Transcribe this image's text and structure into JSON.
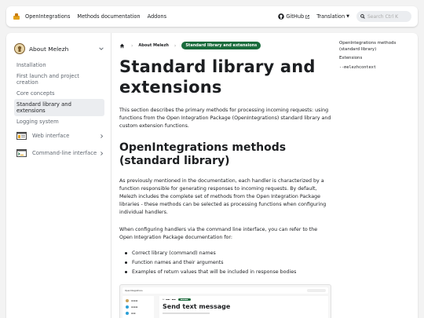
{
  "navbar": {
    "brand": "OpenIntegrations",
    "links": [
      "Methods documentation",
      "Addons"
    ],
    "github": "GitHub",
    "translation": "Translation",
    "search_placeholder": "Search Ctrl K"
  },
  "sidebar": {
    "header": "About Melezh",
    "items": [
      {
        "label": "Installation",
        "active": false
      },
      {
        "label": "First launch and project creation",
        "active": false
      },
      {
        "label": "Core concepts",
        "active": false
      },
      {
        "label": "Standard library and extensions",
        "active": true
      },
      {
        "label": "Logging system",
        "active": false
      }
    ],
    "groups": [
      {
        "label": "Web interface",
        "icon": "web-interface-icon"
      },
      {
        "label": "Command-line interface",
        "icon": "terminal-icon"
      }
    ]
  },
  "breadcrumb": {
    "items": [
      "About Melezh"
    ],
    "active": "Standard library and extensions"
  },
  "content": {
    "title": "Standard library and extensions",
    "intro": "This section describes the primary methods for processing incoming requests: using functions from the Open Integration Package (OpenIntegrations) standard library and custom extension functions.",
    "section_title": "OpenIntegrations methods (standard library)",
    "para1": "As previously mentioned in the documentation, each handler is characterized by a function responsible for generating responses to incoming requests. By default, Melezh includes the complete set of methods from the Open Integration Package libraries - these methods can be selected as processing functions when configuring individual handlers.",
    "para2": "When configuring handlers via the command line interface, you can refer to the Open Integration Package documentation for:",
    "bullets": [
      "Correct library (command) names",
      "Function names and their arguments",
      "Examples of return values that will be included in response bodies"
    ],
    "preview_title": "Send text message"
  },
  "toc": {
    "items": [
      "OpenIntegrations methods (standard library)",
      "Extensions",
      "--melezhcontext"
    ]
  },
  "colors": {
    "accent_green": "#1a6b3c",
    "page_bg": "#f3f3f3",
    "active_bg": "#ebedf0"
  }
}
